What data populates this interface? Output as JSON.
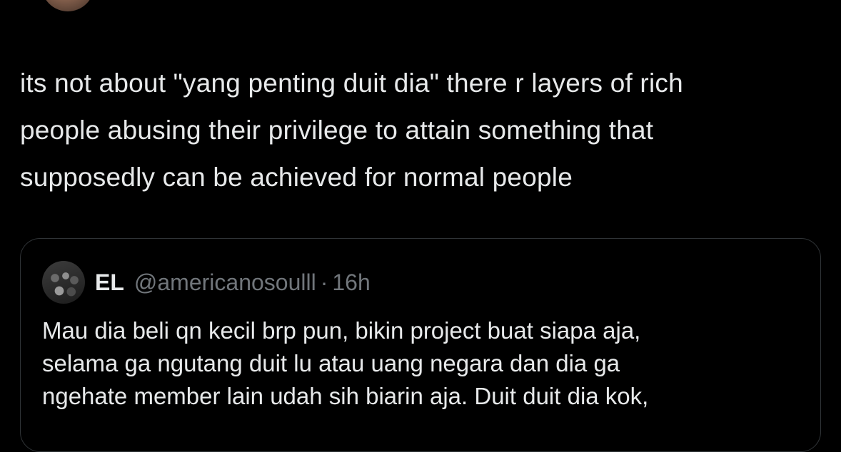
{
  "tweet": {
    "lines": [
      "its not about \"yang penting duit dia\" there r layers of rich",
      "people abusing their privilege to attain something that",
      "supposedly can be achieved for normal people"
    ]
  },
  "quote": {
    "name": "EL",
    "handle": "@americanosoulll",
    "separator": "·",
    "time": "16h",
    "lines": [
      "Mau dia beli qn kecil brp pun, bikin project buat siapa aja,",
      "selama ga ngutang duit lu atau uang negara dan dia ga",
      "ngehate member lain udah sih biarin aja. Duit duit dia kok,"
    ]
  },
  "colors": {
    "background": "#000000",
    "text_primary": "#e7e9ea",
    "text_secondary": "#71767b",
    "border": "#2f3336"
  }
}
